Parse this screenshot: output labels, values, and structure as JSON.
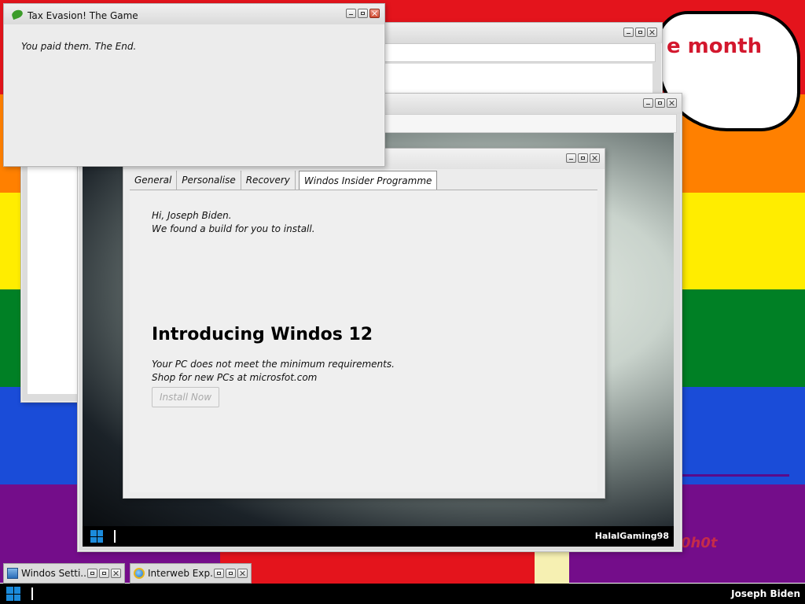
{
  "desktop": {
    "bubble_text": "e month",
    "corner_text": "0h0t",
    "colors": {
      "red": "#e4141c",
      "orange": "#ff8000",
      "yellow": "#ffed00",
      "green": "#008025",
      "blue": "#1a4cd8",
      "purple": "#740d8a"
    }
  },
  "tax_window": {
    "title": "Tax Evasion! The Game",
    "body": "You paid them. The End."
  },
  "settings_window": {
    "tabs": [
      {
        "label": "General"
      },
      {
        "label": "Personalise"
      },
      {
        "label": "Recovery"
      },
      {
        "label": "Windos Insider Programme",
        "active": true
      }
    ],
    "greeting": "Hi, Joseph Biden.",
    "build_msg": "We found a build for you to install.",
    "heading": "Introducing Windos 12",
    "requirements_msg": "Your PC does not meet the minimum requirements.",
    "shop_msg": "Shop for new PCs at microsfot.com",
    "install_button": "Install Now",
    "install_enabled": false
  },
  "vm": {
    "taskbar_user": "HalalGaming98"
  },
  "minimized": [
    {
      "label": "Windos Setti...",
      "icon": "settings-icon"
    },
    {
      "label": "Interweb Exp...",
      "icon": "browser-icon"
    }
  ],
  "taskbar": {
    "user": "Joseph Biden",
    "start_icon": "windows-logo-icon"
  }
}
